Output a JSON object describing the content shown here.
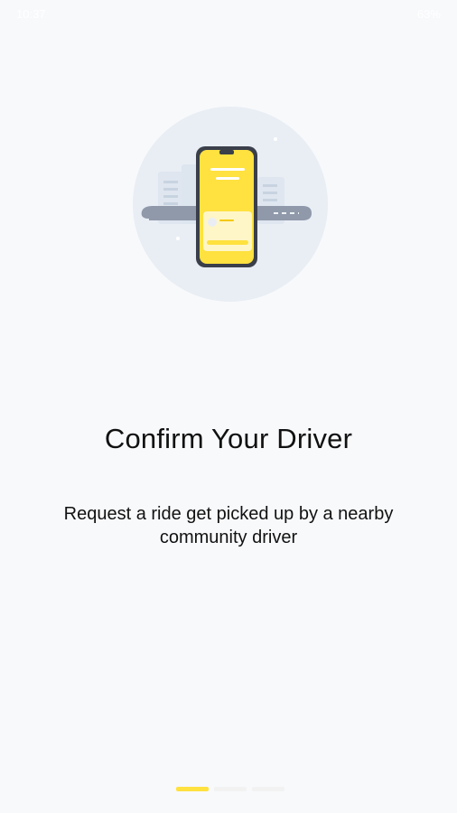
{
  "status_bar": {
    "time": "10:37",
    "right_text": "63%"
  },
  "onboarding": {
    "illustration_icon": "phone-ride-confirmation-illustration",
    "title": "Confirm Your Driver",
    "subtitle": "Request a ride get picked up by a nearby community driver",
    "pager": {
      "total": 3,
      "active_index": 0
    }
  },
  "colors": {
    "background": "#f8f9fb",
    "accent": "#ffe13f",
    "circle": "#e9eef5",
    "road": "#8f99aa",
    "phone_frame": "#3a3f4a"
  }
}
